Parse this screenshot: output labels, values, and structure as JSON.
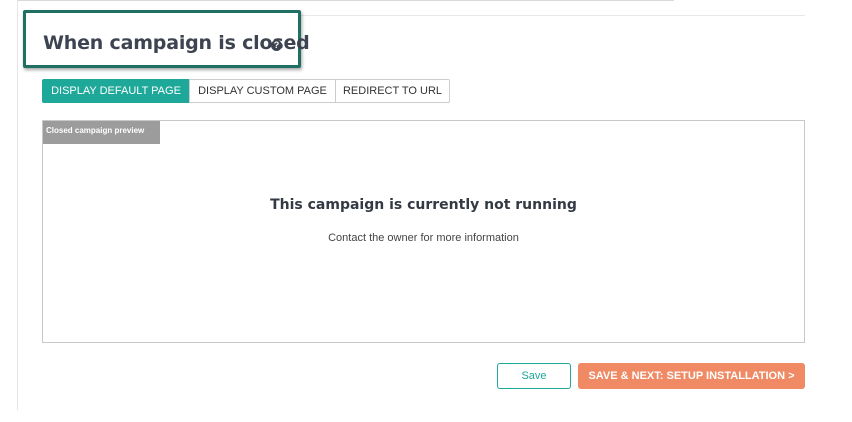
{
  "section": {
    "title": "When campaign is closed",
    "help_icon": "question-circle-icon",
    "help_glyph": "?"
  },
  "tabs": [
    {
      "label": "DISPLAY DEFAULT PAGE",
      "active": true
    },
    {
      "label": "DISPLAY CUSTOM PAGE",
      "active": false
    },
    {
      "label": "REDIRECT TO URL",
      "active": false
    }
  ],
  "preview": {
    "tag": "Closed campaign preview",
    "title": "This campaign is currently not running",
    "subtitle": "Contact the owner for more information"
  },
  "actions": {
    "save_label": "Save",
    "next_label": "SAVE & NEXT: SETUP INSTALLATION >"
  },
  "colors": {
    "accent": "#1ea89a",
    "primary_action": "#ef8a64",
    "highlight_border": "#1f6f63"
  }
}
